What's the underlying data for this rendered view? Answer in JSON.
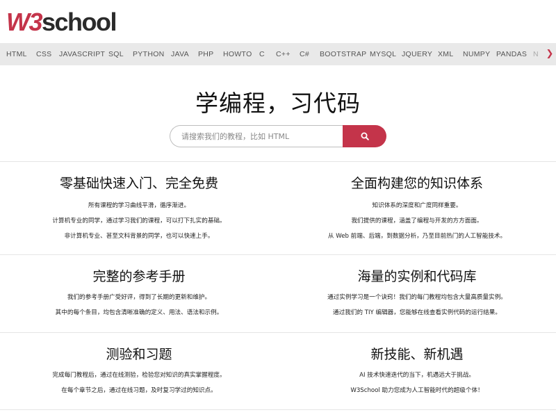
{
  "logo": {
    "w3": "W3",
    "school": "school"
  },
  "nav": {
    "items": [
      "HTML",
      "CSS",
      "JAVASCRIPT",
      "SQL",
      "PYTHON",
      "JAVA",
      "PHP",
      "HOWTO",
      "C",
      "C++",
      "C#",
      "BOOTSTRAP",
      "MYSQL",
      "JQUERY",
      "XML",
      "NUMPY",
      "PANDAS",
      "N"
    ],
    "more_icon": "chevron-right-icon"
  },
  "hero": {
    "title": "学编程，习代码",
    "search_placeholder": "请搜索我们的教程，比如 HTML",
    "search_icon": "search-icon"
  },
  "features": [
    {
      "title": "零基础快速入门、完全免费",
      "lines": [
        "所有课程的学习曲线平滑，循序渐进。",
        "计算机专业的同学，通过学习我们的课程，可以打下扎实的基础。",
        "非计算机专业、甚至文科背景的同学，也可以快速上手。"
      ]
    },
    {
      "title": "全面构建您的知识体系",
      "lines": [
        "知识体系的深度和广度同样重要。",
        "我们提供的课程，涵盖了编程与开发的方方面面。",
        "从 Web 前端、后端，到数据分析，乃至目前热门的人工智能技术。"
      ]
    },
    {
      "title": "完整的参考手册",
      "lines": [
        "我们的参考手册广受好评，得到了长期的更新和维护。",
        "其中的每个条目，均包含清晰准确的定义、用法、语法和示例。"
      ]
    },
    {
      "title": "海量的实例和代码库",
      "lines": [
        "通过实例学习是一个诀窍！我们的每门教程均包含大量高质量实例。",
        "通过我们的 TIY 编辑器，您能够在线查看实例代码的运行结果。"
      ]
    },
    {
      "title": "测验和习题",
      "lines": [
        "完成每门教程后，通过在线测验，检验您对知识的真实掌握程度。",
        "在每个章节之后，通过在线习题，及时复习学过的知识点。"
      ]
    },
    {
      "title": "新技能、新机遇",
      "lines": [
        "AI 技术快速迭代的当下，机遇远大于挑战。",
        "W3School 助力您成为人工智能时代的超级个体！"
      ]
    }
  ]
}
